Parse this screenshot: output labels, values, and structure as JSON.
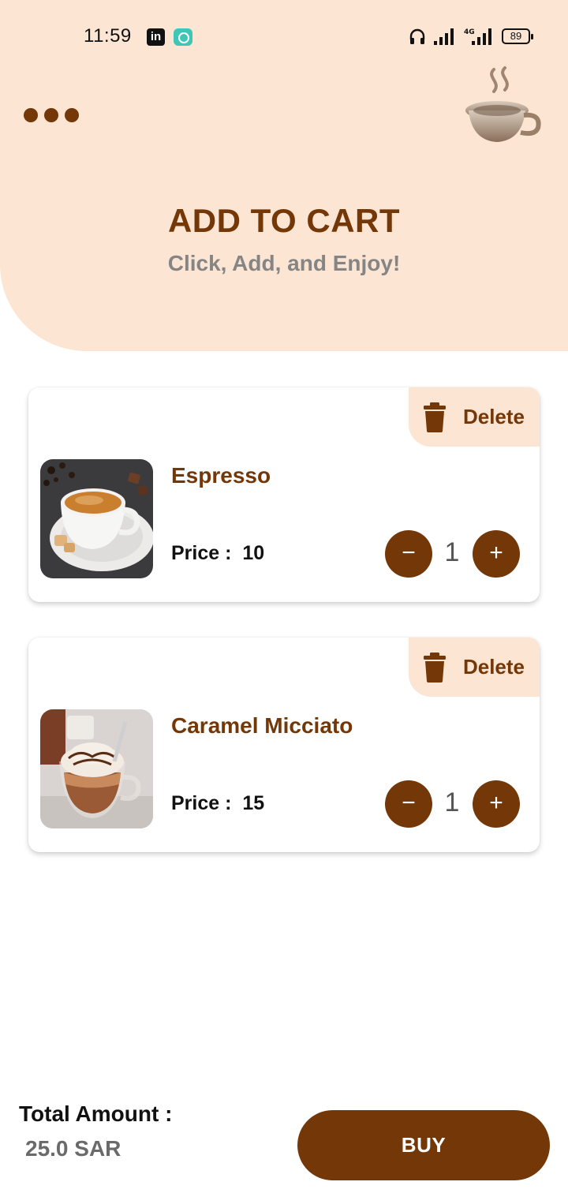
{
  "status_bar": {
    "time": "11:59",
    "linkedin_glyph": "in",
    "battery": "89",
    "icons": [
      "linkedin-icon",
      "chat-app-icon",
      "headset-icon",
      "signal-icon",
      "signal-4g-icon",
      "battery-icon"
    ]
  },
  "header": {
    "title": "ADD TO CART",
    "subtitle": "Click, Add, and Enjoy!",
    "menu_icon": "three-dots-icon",
    "logo_icon": "coffee-cup-logo-icon"
  },
  "cart": {
    "items": [
      {
        "name": "Espresso",
        "price_label": "Price :  ",
        "price": "10",
        "quantity": "1",
        "delete_label": "Delete",
        "minus_glyph": "−",
        "plus_glyph": "+"
      },
      {
        "name": "Caramel Micciato",
        "price_label": "Price :  ",
        "price": "15",
        "quantity": "1",
        "delete_label": "Delete",
        "minus_glyph": "−",
        "plus_glyph": "+"
      }
    ]
  },
  "footer": {
    "total_label": "Total Amount :",
    "total_value": "25.0 SAR",
    "buy_label": "BUY"
  },
  "colors": {
    "accent_brown": "#733708",
    "header_peach": "#fde5d3",
    "subtitle_gray": "#858585"
  }
}
